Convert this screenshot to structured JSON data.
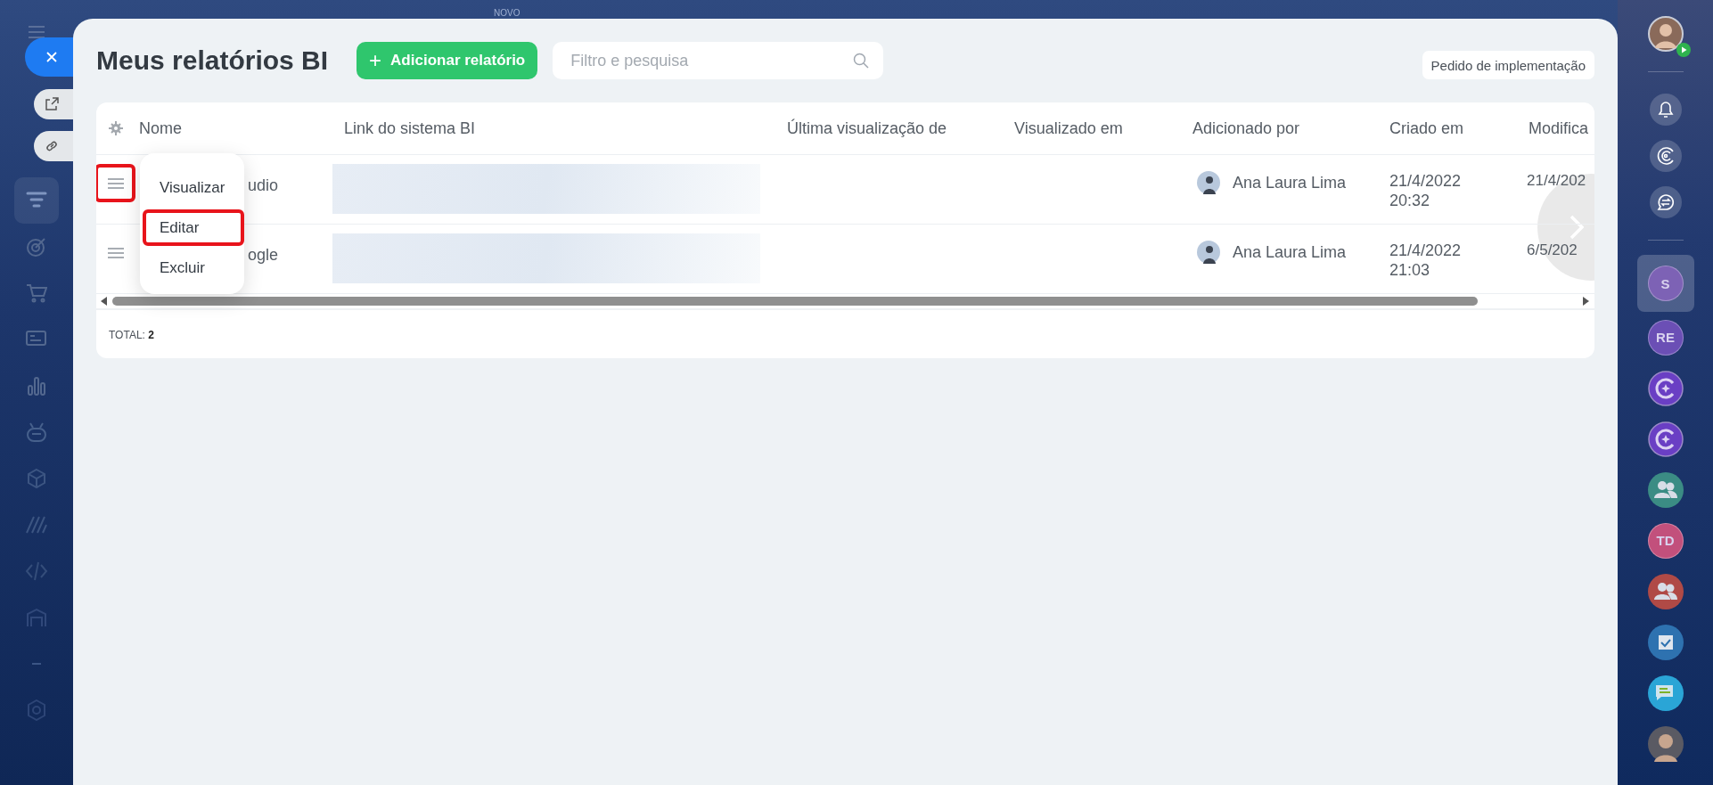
{
  "left_rail": {
    "new_badge": "NOVO"
  },
  "header": {
    "title": "Meus relatórios BI",
    "add_icon": "+",
    "add_button": "Adicionar relatório",
    "search": {
      "placeholder": "Filtro e pesquisa"
    },
    "request_button": "Pedido de implementação"
  },
  "table": {
    "columns": [
      "Nome",
      "Link do sistema BI",
      "Última visualização de",
      "Visualizado em",
      "Adicionado por",
      "Criado em",
      "Modifica"
    ],
    "rows": [
      {
        "name": "udio",
        "added_by": "Ana Laura Lima",
        "created_date": "21/4/2022",
        "created_time": "20:32",
        "modified": "21/4/202",
        "handle_highlighted": true
      },
      {
        "name": "ogle",
        "added_by": "Ana Laura Lima",
        "created_date": "21/4/2022",
        "created_time": "21:03",
        "modified": "6/5/202",
        "handle_highlighted": false
      }
    ],
    "total_label": "TOTAL:",
    "total": "2"
  },
  "context_menu": [
    {
      "label": "Visualizar",
      "highlighted": false
    },
    {
      "label": "Editar",
      "highlighted": true
    },
    {
      "label": "Excluir",
      "highlighted": false
    }
  ],
  "right_rail": {
    "items": [
      {
        "kind": "initials",
        "text": "S",
        "color": "#7d62b5",
        "selected": true
      },
      {
        "kind": "initials",
        "text": "RE",
        "color": "#6b4fb5",
        "selected": false
      },
      {
        "kind": "channel",
        "color": "#6a3fc4",
        "selected": false
      },
      {
        "kind": "channel",
        "color": "#6a3fc4",
        "selected": false
      },
      {
        "kind": "group",
        "color": "#3b8c84",
        "selected": false
      },
      {
        "kind": "initials",
        "text": "TD",
        "color": "#c2507c",
        "selected": false
      },
      {
        "kind": "group",
        "color": "#b04a46",
        "selected": false
      },
      {
        "kind": "tasks",
        "color": "#2e72b0",
        "selected": false
      },
      {
        "kind": "chat",
        "color": "#2aa5d6",
        "selected": false
      },
      {
        "kind": "photo",
        "selected": false
      }
    ]
  }
}
